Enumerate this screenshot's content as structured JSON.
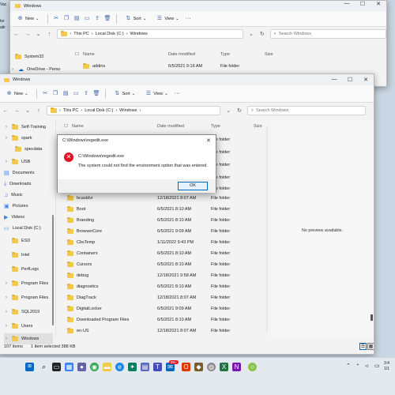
{
  "back_window": {
    "title": "Windows",
    "new_label": "New",
    "sort_label": "Sort",
    "view_label": "View",
    "more_label": "···",
    "breadcrumb": [
      "This PC",
      "Local Disk (C:)",
      "Windows"
    ],
    "search_placeholder": "Search Windows",
    "columns": [
      "Name",
      "Date modified",
      "Type",
      "Size"
    ],
    "nav": [
      "System32",
      "OneDrive - Perso"
    ],
    "row": {
      "name": "addins",
      "date": "6/5/2021 9:16 AM",
      "type": "File folder"
    },
    "edge_text": [
      "Vac",
      "tor",
      "atir"
    ]
  },
  "front_window": {
    "title": "Windows",
    "new_label": "New",
    "sort_label": "Sort",
    "view_label": "View",
    "more_label": "···",
    "breadcrumb": [
      "This PC",
      "Local Disk (C:)",
      "Windows"
    ],
    "search_placeholder": "Search Windows",
    "columns": [
      "Name",
      "Date modified",
      "Type",
      "Size"
    ],
    "nav": [
      "Self-Training",
      "spark",
      "specdata",
      "USB",
      "Documents",
      "Downloads",
      "Music",
      "Pictures",
      "Videos",
      "Local Disk (C:)",
      "ESD",
      "Intel",
      "PerfLogs",
      "Program Files",
      "Program Files",
      "SQL2019",
      "Users",
      "Windows"
    ],
    "rows": [
      {
        "name": "",
        "date": "",
        "type": "File folder"
      },
      {
        "name": "",
        "date": "",
        "type": "File folder"
      },
      {
        "name": "",
        "date": "",
        "type": "File folder"
      },
      {
        "name": "",
        "date": "",
        "type": "File folder"
      },
      {
        "name": "",
        "date": "",
        "type": "File folder"
      },
      {
        "name": "bcastdvr",
        "date": "12/18/2021 8:07 AM",
        "type": "File folder"
      },
      {
        "name": "Boot",
        "date": "6/5/2021 8:10 AM",
        "type": "File folder"
      },
      {
        "name": "Branding",
        "date": "6/5/2021 8:10 AM",
        "type": "File folder"
      },
      {
        "name": "BrowserCore",
        "date": "6/5/2021 9:09 AM",
        "type": "File folder"
      },
      {
        "name": "CbsTemp",
        "date": "1/11/2022 9:43 PM",
        "type": "File folder"
      },
      {
        "name": "Containers",
        "date": "6/5/2021 8:10 AM",
        "type": "File folder"
      },
      {
        "name": "Cursors",
        "date": "6/5/2021 8:10 AM",
        "type": "File folder"
      },
      {
        "name": "debug",
        "date": "12/18/2021 9:58 AM",
        "type": "File folder"
      },
      {
        "name": "diagnostics",
        "date": "6/5/2021 8:10 AM",
        "type": "File folder"
      },
      {
        "name": "DiagTrack",
        "date": "12/18/2021 8:07 AM",
        "type": "File folder"
      },
      {
        "name": "DigitalLocker",
        "date": "6/5/2021 9:09 AM",
        "type": "File folder"
      },
      {
        "name": "Downloaded Program Files",
        "date": "6/5/2021 8:10 AM",
        "type": "File folder"
      },
      {
        "name": "en-US",
        "date": "12/18/2021 8:07 AM",
        "type": "File folder"
      }
    ],
    "preview_text": "No preview available.",
    "status_items": "107 items",
    "status_selected": "1 item selected  388 KB"
  },
  "dialog": {
    "title": "C:\\Windows\\regedit.exe",
    "path": "C:\\Windows\\regedit.exe",
    "message": "The system could not find the environment option that was entered.",
    "ok_label": "OK",
    "close_glyph": "✕"
  },
  "taskbar": {
    "badge": "99+",
    "time": "3:4",
    "date": "1/1"
  },
  "colors": {
    "accent": "#0067c0",
    "folder": "#f2c94c",
    "error": "#e81123"
  }
}
